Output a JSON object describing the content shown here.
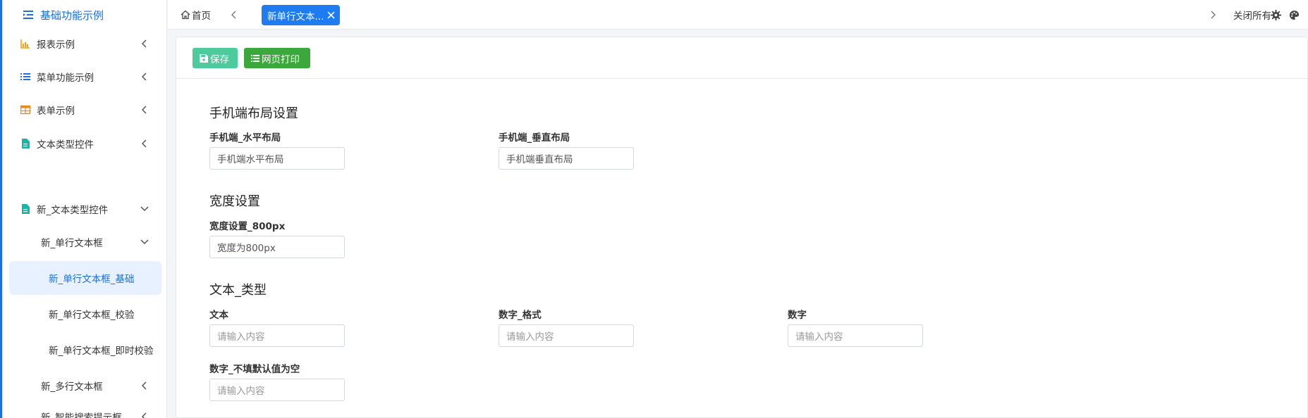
{
  "sidebar": {
    "header": {
      "label": "基础功能示例",
      "icon": "list-indent-icon"
    },
    "items": [
      {
        "label": "报表示例",
        "icon": "chart-icon"
      },
      {
        "label": "菜单功能示例",
        "icon": "list-icon"
      },
      {
        "label": "表单示例",
        "icon": "table-icon"
      },
      {
        "label": "文本类型控件",
        "icon": "file-icon"
      },
      {
        "label": "新_文本类型控件",
        "icon": "file-icon"
      },
      {
        "label": "新_单行文本框"
      },
      {
        "label": "新_单行文本框_基础"
      },
      {
        "label": "新_单行文本框_校验"
      },
      {
        "label": "新_单行文本框_即时校验"
      },
      {
        "label": "新_多行文本框"
      },
      {
        "label": "新_智能搜索提示框"
      }
    ]
  },
  "topbar": {
    "home_label": "首页",
    "active_tab": "新单行文本...",
    "close_all_label": "关闭所有"
  },
  "toolbar": {
    "save_label": "保存",
    "print_label": "网页打印"
  },
  "sections": {
    "mobile_layout": {
      "title": "手机端布局设置",
      "field1_label": "手机端_水平布局",
      "field1_value": "手机端水平布局",
      "field2_label": "手机端_垂直布局",
      "field2_value": "手机端垂直布局"
    },
    "width": {
      "title": "宽度设置",
      "field_label": "宽度设置_800px",
      "field_value": "宽度为800px"
    },
    "text_type": {
      "title": "文本_类型",
      "text_label": "文本",
      "number_format_label": "数字_格式",
      "number_label": "数字",
      "number_empty_label": "数字_不填默认值为空",
      "placeholder": "请输入内容"
    }
  },
  "colors": {
    "accent": "#1e7bf0",
    "save_button": "#4ecb9c",
    "print_button": "#3aa83a",
    "active_menu_bg": "#e8f1ff"
  }
}
